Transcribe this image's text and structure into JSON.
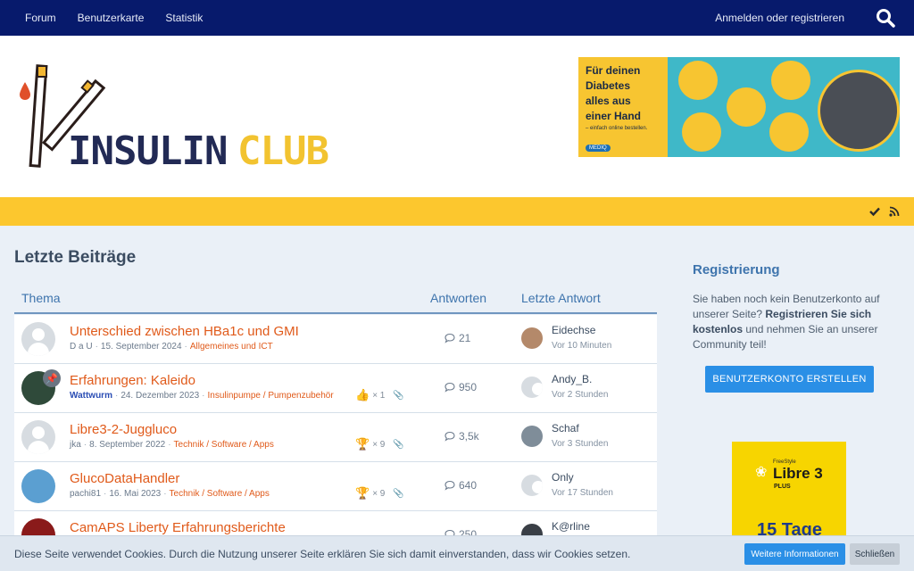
{
  "topnav": {
    "items": [
      {
        "label": "Forum"
      },
      {
        "label": "Benutzerkarte"
      },
      {
        "label": "Statistik"
      }
    ],
    "login_label": "Anmelden oder registrieren",
    "search_icon": "search-icon"
  },
  "header": {
    "logo_text_1": "INSULIN",
    "logo_text_2": "CLUB",
    "ad": {
      "headline": "Für deinen\nDiabetes\nalles aus\neiner Hand",
      "subline": "– einfach online bestellen.",
      "brand": "MEDIQ"
    }
  },
  "page": {
    "title": "Letzte Beiträge",
    "columns": {
      "thema": "Thema",
      "antworten": "Antworten",
      "letzte": "Letzte Antwort"
    }
  },
  "threads": [
    {
      "title": "Unterschied zwischen HBa1c und GMI",
      "author": "D a U",
      "date": "15. September 2024",
      "forum": "Allgemeines und ICT",
      "extra": "",
      "attachment": false,
      "replies": "21",
      "last_user": "Eidechse",
      "last_time": "Vor 10 Minuten"
    },
    {
      "title": "Erfahrungen: Kaleido",
      "author": "Wattwurm",
      "date": "24. Dezember 2023",
      "forum": "Insulinpumpe / Pumpenzubehör",
      "extra": "× 1",
      "attachment": true,
      "replies": "950",
      "last_user": "Andy_B.",
      "last_time": "Vor 2 Stunden"
    },
    {
      "title": "Libre3-2-Juggluco",
      "author": "jka",
      "date": "8. September 2022",
      "forum": "Technik / Software / Apps",
      "extra": "× 9",
      "attachment": true,
      "replies": "3,5k",
      "last_user": "Schaf",
      "last_time": "Vor 3 Stunden"
    },
    {
      "title": "GlucoDataHandler",
      "author": "pachi81",
      "date": "16. Mai 2023",
      "forum": "Technik / Software / Apps",
      "extra": "× 9",
      "attachment": true,
      "replies": "640",
      "last_user": "Only",
      "last_time": "Vor 17 Stunden"
    },
    {
      "title": "CamAPS Liberty Erfahrungsberichte",
      "author": "",
      "date": "",
      "forum": "",
      "extra": "",
      "attachment": false,
      "replies": "250",
      "last_user": "K@rline",
      "last_time": ""
    }
  ],
  "sidebar": {
    "title": "Registrierung",
    "text_1": "Sie haben noch kein Benutzerkonto auf unserer Seite? ",
    "text_bold": "Registrieren Sie sich kostenlos",
    "text_2": " und nehmen Sie an unserer Community teil!",
    "button_label": "BENUTZERKONTO ERSTELLEN",
    "ad": {
      "brand_small": "FreeStyle",
      "brand": "Libre 3",
      "plus": "PLUS",
      "promo": "15 Tage"
    }
  },
  "cookie": {
    "text": "Diese Seite verwendet Cookies. Durch die Nutzung unserer Seite erklären Sie sich damit einverstanden, dass wir Cookies setzen.",
    "more_label": "Weitere Informationen",
    "close_label": "Schließen"
  },
  "colors": {
    "nav": "#071a6c",
    "accent_yellow": "#fcc72e",
    "link_orange": "#e05a1a",
    "button_blue": "#2a8fe6"
  }
}
